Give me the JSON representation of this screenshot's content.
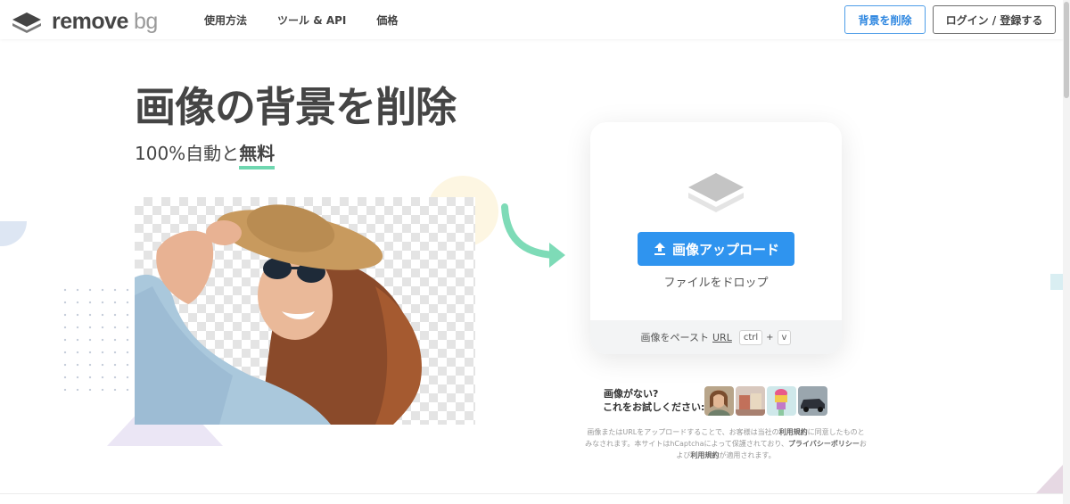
{
  "brand": {
    "name_part1": "remove",
    "name_part2": "bg"
  },
  "nav": {
    "items": [
      "使用方法",
      "ツール & API",
      "価格"
    ]
  },
  "header": {
    "remove_bg_button": "背景を削除",
    "login_button": "ログイン / 登録する"
  },
  "hero": {
    "title": "画像の背景を削除",
    "subtitle_prefix": "100%自動と",
    "subtitle_highlight": "無料"
  },
  "upload": {
    "button_label": "画像アップロード",
    "drop_text": "ファイルをドロップ",
    "paste_text": "画像をペースト",
    "url_text": "URL",
    "kbd_ctrl": "ctrl",
    "kbd_plus": "+",
    "kbd_v": "v"
  },
  "samples": {
    "line1": "画像がない?",
    "line2": "これをお試しください:"
  },
  "legal": {
    "part1": "画像またはURLをアップロードすることで、お客様は当社の",
    "terms1": "利用規約",
    "part2": "に同意したものとみなされます。本サイトはhCaptchaによって保護されており、",
    "privacy": "プライバシーポリシー",
    "part3": "および",
    "terms2": "利用規約",
    "part4": "が適用されます。"
  },
  "colors": {
    "accent_blue": "#2f94ef",
    "highlight_green": "#6fd7b0",
    "text_dark": "#454545"
  }
}
